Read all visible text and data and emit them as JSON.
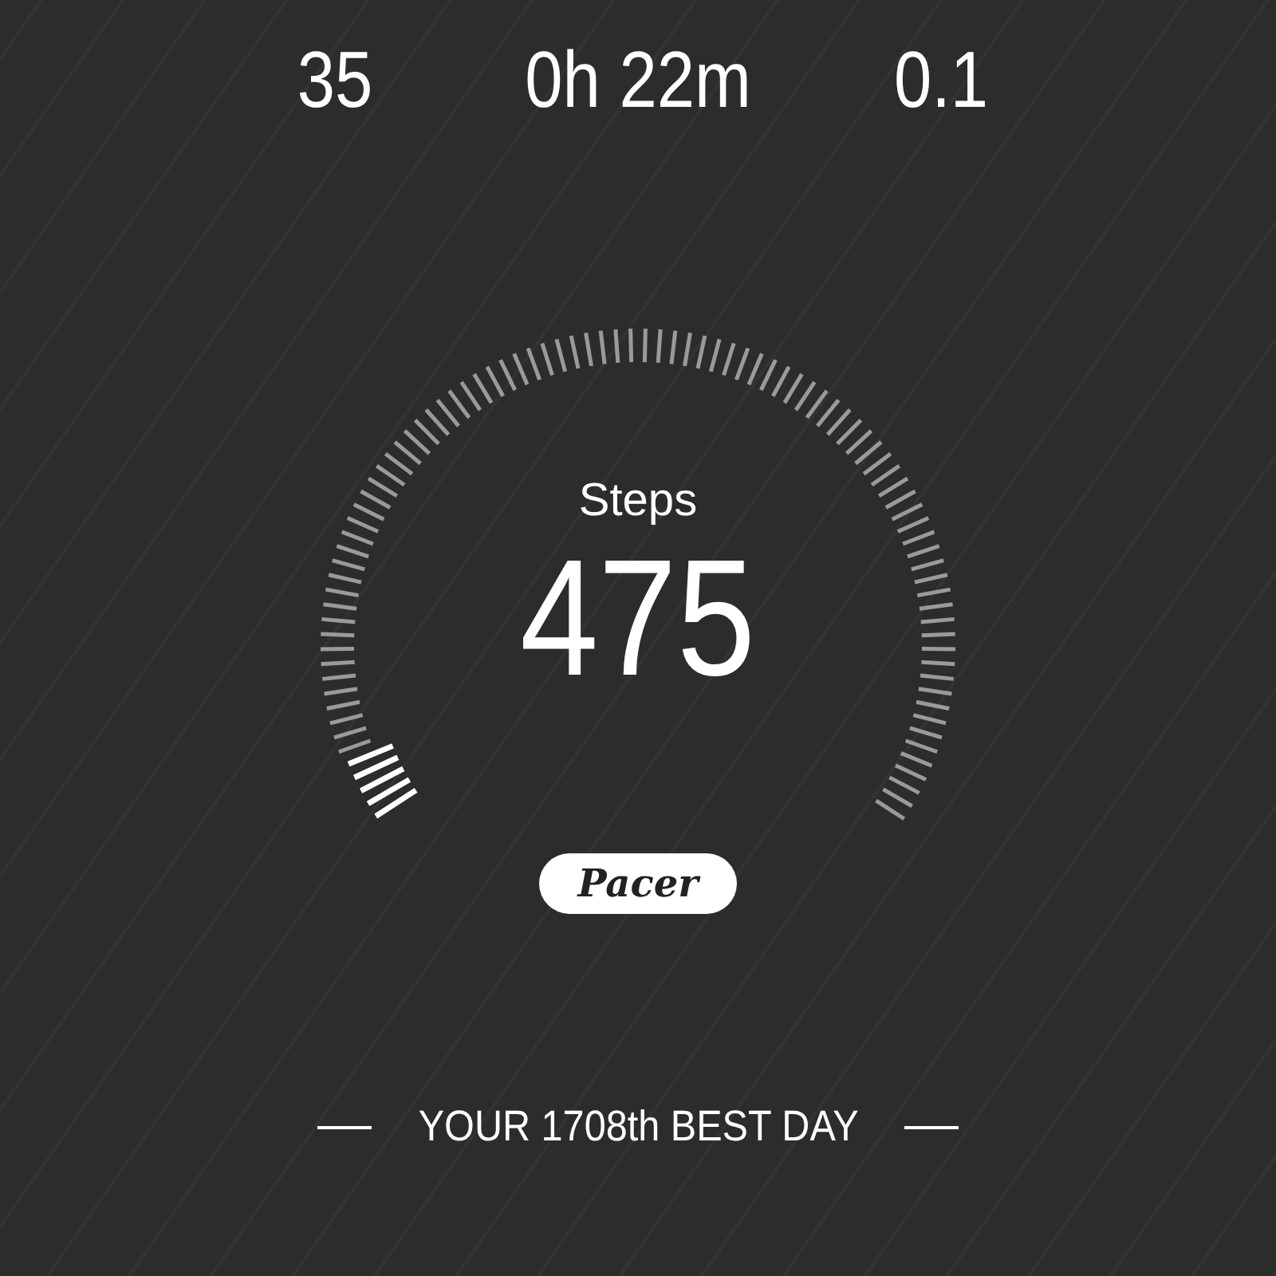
{
  "stats": [
    {
      "value": "35"
    },
    {
      "value": "0h 22m"
    },
    {
      "value": "0.1"
    }
  ],
  "gauge": {
    "label": "Steps",
    "value": "475"
  },
  "logo": "Pacer",
  "best_day": "YOUR 1708th BEST DAY"
}
